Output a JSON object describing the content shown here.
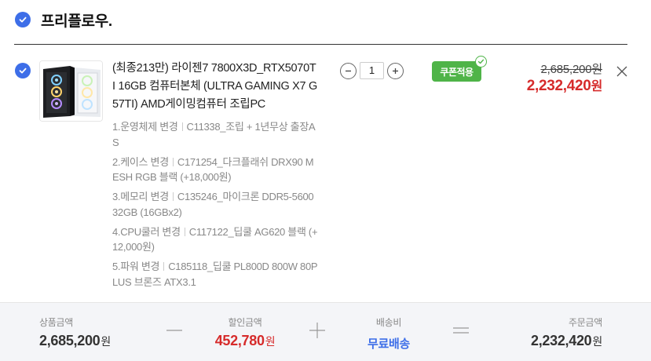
{
  "seller": {
    "name": "프리플로우."
  },
  "item": {
    "name": "(최종213만) 라이젠7 7800X3D_RTX5070TI 16GB 컴퓨터본체 (ULTRA GAMING X7 G57TI) AMD게이밍컴퓨터 조립PC",
    "options": [
      {
        "label": "1.운영체제 변경",
        "value": "C11338_조립 + 1년무상 출장AS"
      },
      {
        "label": "2.케이스 변경",
        "value": "C171254_다크플래쉬 DRX90 MESH RGB 블랙 (+18,000원)"
      },
      {
        "label": "3.메모리 변경",
        "value": "C135246_마이크론 DDR5-5600 32GB (16GBx2)"
      },
      {
        "label": "4.CPU쿨러 변경",
        "value": "C117122_딥쿨 AG620 블랙 (+12,000원)"
      },
      {
        "label": "5.파워 변경",
        "value": "C185118_딥쿨 PL800D 800W 80PLUS 브론즈 ATX3.1"
      }
    ],
    "quantity": "1",
    "coupon_label": "쿠폰적용",
    "original_price": "2,685,200원",
    "final_price_number": "2,232,420",
    "final_price_unit": "원"
  },
  "summary": {
    "product_amount_label": "상품금액",
    "product_amount_value": "2,685,200",
    "discount_label": "할인금액",
    "discount_value": "452,780",
    "shipping_label": "배송비",
    "shipping_value": "무료배송",
    "order_amount_label": "주문금액",
    "order_amount_value": "2,232,420",
    "unit": "원"
  },
  "colors": {
    "accent_blue": "#3d6ee8",
    "price_red": "#d62b2b",
    "coupon_green": "#4fb448"
  },
  "icons": {
    "select_seller": "check-circle-icon",
    "select_item": "check-circle-icon",
    "quantity_decrease": "minus-circle-icon",
    "quantity_increase": "plus-circle-icon",
    "coupon_applied": "check-badge-icon",
    "remove_item": "close-icon"
  }
}
